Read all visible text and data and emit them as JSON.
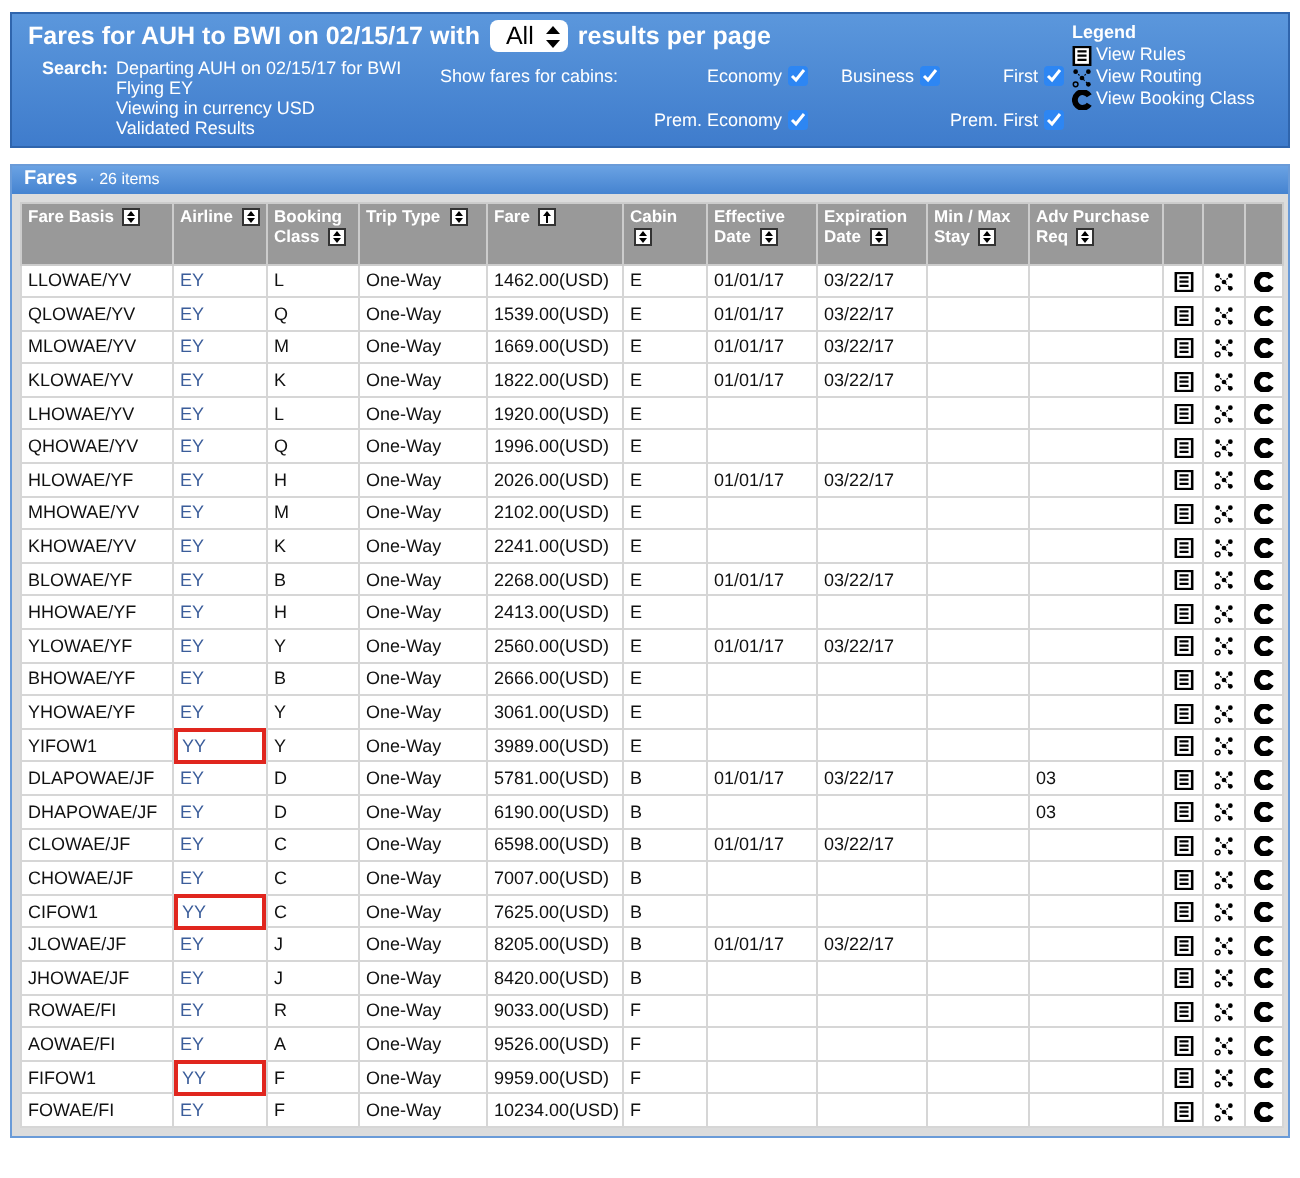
{
  "header": {
    "title_prefix": "Fares for AUH to BWI on 02/15/17 with",
    "per_page": "All",
    "title_suffix": "results per page",
    "search_label": "Search:",
    "search_lines": [
      "Departing AUH on 02/15/17 for BWI",
      "Flying EY",
      "Viewing in currency USD",
      "Validated Results"
    ],
    "cabins_label": "Show fares for cabins:",
    "cabins": [
      {
        "label": "Economy",
        "checked": true
      },
      {
        "label": "Business",
        "checked": true
      },
      {
        "label": "First",
        "checked": true
      },
      {
        "label": "Prem. Economy",
        "checked": true
      },
      {
        "label": "Prem. First",
        "checked": true
      }
    ],
    "legend_title": "Legend",
    "legend": [
      {
        "kind": "rules",
        "label": "View Rules"
      },
      {
        "kind": "routing",
        "label": "View Routing"
      },
      {
        "kind": "booking",
        "label": "View Booking Class"
      }
    ]
  },
  "panel": {
    "title": "Fares",
    "count": "· 26 items"
  },
  "columns": [
    {
      "label": "Fare Basis",
      "sorted": false
    },
    {
      "label": "Airline",
      "sorted": false
    },
    {
      "label": "Booking Class",
      "sorted": false
    },
    {
      "label": "Trip Type",
      "sorted": false
    },
    {
      "label": "Fare",
      "sorted": true
    },
    {
      "label": "Cabin",
      "sorted": false
    },
    {
      "label": "Effective Date",
      "sorted": false
    },
    {
      "label": "Expiration Date",
      "sorted": false
    },
    {
      "label": "Min / Max Stay",
      "sorted": false
    },
    {
      "label": "Adv Purchase Req",
      "sorted": false
    }
  ],
  "rows": [
    {
      "cells": [
        "LLOWAE/YV",
        "EY",
        "L",
        "One-Way",
        "1462.00(USD)",
        "E",
        "01/01/17",
        "03/22/17",
        null,
        null
      ],
      "highlighted": false
    },
    {
      "cells": [
        "QLOWAE/YV",
        "EY",
        "Q",
        "One-Way",
        "1539.00(USD)",
        "E",
        "01/01/17",
        "03/22/17",
        null,
        null
      ],
      "highlighted": false
    },
    {
      "cells": [
        "MLOWAE/YV",
        "EY",
        "M",
        "One-Way",
        "1669.00(USD)",
        "E",
        "01/01/17",
        "03/22/17",
        null,
        null
      ],
      "highlighted": false
    },
    {
      "cells": [
        "KLOWAE/YV",
        "EY",
        "K",
        "One-Way",
        "1822.00(USD)",
        "E",
        "01/01/17",
        "03/22/17",
        null,
        null
      ],
      "highlighted": false
    },
    {
      "cells": [
        "LHOWAE/YV",
        "EY",
        "L",
        "One-Way",
        "1920.00(USD)",
        "E",
        null,
        null,
        null,
        null
      ],
      "highlighted": false
    },
    {
      "cells": [
        "QHOWAE/YV",
        "EY",
        "Q",
        "One-Way",
        "1996.00(USD)",
        "E",
        null,
        null,
        null,
        null
      ],
      "highlighted": false
    },
    {
      "cells": [
        "HLOWAE/YF",
        "EY",
        "H",
        "One-Way",
        "2026.00(USD)",
        "E",
        "01/01/17",
        "03/22/17",
        null,
        null
      ],
      "highlighted": false
    },
    {
      "cells": [
        "MHOWAE/YV",
        "EY",
        "M",
        "One-Way",
        "2102.00(USD)",
        "E",
        null,
        null,
        null,
        null
      ],
      "highlighted": false
    },
    {
      "cells": [
        "KHOWAE/YV",
        "EY",
        "K",
        "One-Way",
        "2241.00(USD)",
        "E",
        null,
        null,
        null,
        null
      ],
      "highlighted": false
    },
    {
      "cells": [
        "BLOWAE/YF",
        "EY",
        "B",
        "One-Way",
        "2268.00(USD)",
        "E",
        "01/01/17",
        "03/22/17",
        null,
        null
      ],
      "highlighted": false
    },
    {
      "cells": [
        "HHOWAE/YF",
        "EY",
        "H",
        "One-Way",
        "2413.00(USD)",
        "E",
        null,
        null,
        null,
        null
      ],
      "highlighted": false
    },
    {
      "cells": [
        "YLOWAE/YF",
        "EY",
        "Y",
        "One-Way",
        "2560.00(USD)",
        "E",
        "01/01/17",
        "03/22/17",
        null,
        null
      ],
      "highlighted": false
    },
    {
      "cells": [
        "BHOWAE/YF",
        "EY",
        "B",
        "One-Way",
        "2666.00(USD)",
        "E",
        null,
        null,
        null,
        null
      ],
      "highlighted": false
    },
    {
      "cells": [
        "YHOWAE/YF",
        "EY",
        "Y",
        "One-Way",
        "3061.00(USD)",
        "E",
        null,
        null,
        null,
        null
      ],
      "highlighted": false
    },
    {
      "cells": [
        "YIFOW1",
        "YY",
        "Y",
        "One-Way",
        "3989.00(USD)",
        "E",
        null,
        null,
        null,
        null
      ],
      "highlighted": true
    },
    {
      "cells": [
        "DLAPOWAE/JF",
        "EY",
        "D",
        "One-Way",
        "5781.00(USD)",
        "B",
        "01/01/17",
        "03/22/17",
        null,
        "03"
      ],
      "highlighted": false
    },
    {
      "cells": [
        "DHAPOWAE/JF",
        "EY",
        "D",
        "One-Way",
        "6190.00(USD)",
        "B",
        null,
        null,
        null,
        "03"
      ],
      "highlighted": false
    },
    {
      "cells": [
        "CLOWAE/JF",
        "EY",
        "C",
        "One-Way",
        "6598.00(USD)",
        "B",
        "01/01/17",
        "03/22/17",
        null,
        null
      ],
      "highlighted": false
    },
    {
      "cells": [
        "CHOWAE/JF",
        "EY",
        "C",
        "One-Way",
        "7007.00(USD)",
        "B",
        null,
        null,
        null,
        null
      ],
      "highlighted": false
    },
    {
      "cells": [
        "CIFOW1",
        "YY",
        "C",
        "One-Way",
        "7625.00(USD)",
        "B",
        null,
        null,
        null,
        null
      ],
      "highlighted": true
    },
    {
      "cells": [
        "JLOWAE/JF",
        "EY",
        "J",
        "One-Way",
        "8205.00(USD)",
        "B",
        "01/01/17",
        "03/22/17",
        null,
        null
      ],
      "highlighted": false
    },
    {
      "cells": [
        "JHOWAE/JF",
        "EY",
        "J",
        "One-Way",
        "8420.00(USD)",
        "B",
        null,
        null,
        null,
        null
      ],
      "highlighted": false
    },
    {
      "cells": [
        "ROWAE/FI",
        "EY",
        "R",
        "One-Way",
        "9033.00(USD)",
        "F",
        null,
        null,
        null,
        null
      ],
      "highlighted": false
    },
    {
      "cells": [
        "AOWAE/FI",
        "EY",
        "A",
        "One-Way",
        "9526.00(USD)",
        "F",
        null,
        null,
        null,
        null
      ],
      "highlighted": false
    },
    {
      "cells": [
        "FIFOW1",
        "YY",
        "F",
        "One-Way",
        "9959.00(USD)",
        "F",
        null,
        null,
        null,
        null
      ],
      "highlighted": true
    },
    {
      "cells": [
        "FOWAE/FI",
        "EY",
        "F",
        "One-Way",
        "10234.00(USD)",
        "F",
        null,
        null,
        null,
        null
      ],
      "highlighted": false
    }
  ]
}
